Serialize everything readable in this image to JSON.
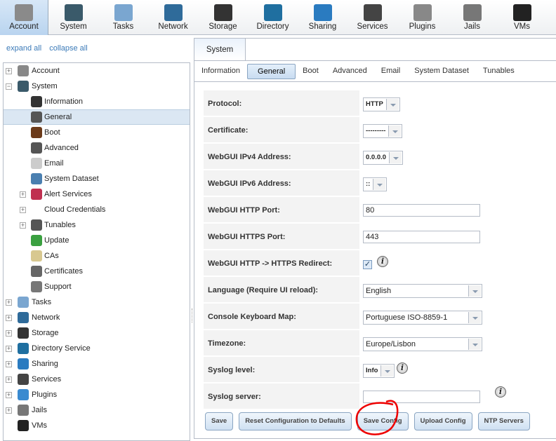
{
  "topnav": [
    {
      "label": "Account",
      "icon": "account-icon",
      "color": "#8a8a8a"
    },
    {
      "label": "System",
      "icon": "system-icon",
      "color": "#3a5a6a"
    },
    {
      "label": "Tasks",
      "icon": "tasks-icon",
      "color": "#7aa6d0"
    },
    {
      "label": "Network",
      "icon": "network-icon",
      "color": "#2f6b9a"
    },
    {
      "label": "Storage",
      "icon": "storage-icon",
      "color": "#333333"
    },
    {
      "label": "Directory",
      "icon": "directory-icon",
      "color": "#1f6fa0"
    },
    {
      "label": "Sharing",
      "icon": "sharing-icon",
      "color": "#2a7bc0"
    },
    {
      "label": "Services",
      "icon": "services-icon",
      "color": "#444444"
    },
    {
      "label": "Plugins",
      "icon": "plugins-icon",
      "color": "#888888"
    },
    {
      "label": "Jails",
      "icon": "jails-icon",
      "color": "#777777"
    },
    {
      "label": "VMs",
      "icon": "vms-icon",
      "color": "#222222"
    }
  ],
  "left": {
    "expand_all": "expand all",
    "collapse_all": "collapse all"
  },
  "tree": [
    {
      "label": "Account",
      "level": 0,
      "exp": "+",
      "icon": "account-icon",
      "color": "#888888"
    },
    {
      "label": "System",
      "level": 0,
      "exp": "−",
      "icon": "system-icon",
      "color": "#3a5a6a"
    },
    {
      "label": "Information",
      "level": 1,
      "icon": "information-icon",
      "color": "#333333"
    },
    {
      "label": "General",
      "level": 1,
      "icon": "wrench-icon",
      "color": "#555555",
      "selected": true
    },
    {
      "label": "Boot",
      "level": 1,
      "icon": "boot-icon",
      "color": "#6b3a1a"
    },
    {
      "label": "Advanced",
      "level": 1,
      "icon": "wrench-icon",
      "color": "#555555"
    },
    {
      "label": "Email",
      "level": 1,
      "icon": "email-icon",
      "color": "#cccccc"
    },
    {
      "label": "System Dataset",
      "level": 1,
      "icon": "dataset-icon",
      "color": "#4a7fb0"
    },
    {
      "label": "Alert Services",
      "level": 1,
      "exp": "+",
      "icon": "alert-icon",
      "color": "#c03050"
    },
    {
      "label": "Cloud Credentials",
      "level": 1,
      "exp": "+",
      "icon": "",
      "color": ""
    },
    {
      "label": "Tunables",
      "level": 1,
      "exp": "+",
      "icon": "tunables-icon",
      "color": "#555555"
    },
    {
      "label": "Update",
      "level": 1,
      "icon": "update-icon",
      "color": "#3aa040"
    },
    {
      "label": "CAs",
      "level": 1,
      "icon": "ca-icon",
      "color": "#d8c890"
    },
    {
      "label": "Certificates",
      "level": 1,
      "icon": "certificate-icon",
      "color": "#666666"
    },
    {
      "label": "Support",
      "level": 1,
      "icon": "support-icon",
      "color": "#777777"
    },
    {
      "label": "Tasks",
      "level": 0,
      "exp": "+",
      "icon": "tasks-icon",
      "color": "#7aa6d0"
    },
    {
      "label": "Network",
      "level": 0,
      "exp": "+",
      "icon": "network-icon",
      "color": "#2f6b9a"
    },
    {
      "label": "Storage",
      "level": 0,
      "exp": "+",
      "icon": "storage-icon",
      "color": "#333333"
    },
    {
      "label": "Directory Service",
      "level": 0,
      "exp": "+",
      "icon": "directory-icon",
      "color": "#1f6fa0"
    },
    {
      "label": "Sharing",
      "level": 0,
      "exp": "+",
      "icon": "sharing-icon",
      "color": "#2a7bc0"
    },
    {
      "label": "Services",
      "level": 0,
      "exp": "+",
      "icon": "services-icon",
      "color": "#444444"
    },
    {
      "label": "Plugins",
      "level": 0,
      "exp": "+",
      "icon": "plugins-icon",
      "color": "#3a8ad0"
    },
    {
      "label": "Jails",
      "level": 0,
      "exp": "+",
      "icon": "jails-icon",
      "color": "#777777"
    },
    {
      "label": "VMs",
      "level": 0,
      "icon": "vms-icon",
      "color": "#222222"
    }
  ],
  "main": {
    "section_tab": "System",
    "subtabs": [
      "Information",
      "General",
      "Boot",
      "Advanced",
      "Email",
      "System Dataset",
      "Tunables"
    ],
    "active_subtab": "General",
    "fields": [
      {
        "label": "Protocol:",
        "type": "select",
        "value": "HTTP"
      },
      {
        "label": "Certificate:",
        "type": "select",
        "value": "---------"
      },
      {
        "label": "WebGUI IPv4 Address:",
        "type": "select",
        "value": "0.0.0.0"
      },
      {
        "label": "WebGUI IPv6 Address:",
        "type": "select",
        "value": "::"
      },
      {
        "label": "WebGUI HTTP Port:",
        "type": "text",
        "value": "80"
      },
      {
        "label": "WebGUI HTTPS Port:",
        "type": "text",
        "value": "443"
      },
      {
        "label": "WebGUI HTTP -> HTTPS Redirect:",
        "type": "checkbox",
        "value": true,
        "info": true
      },
      {
        "label": "Language (Require UI reload):",
        "type": "wideselect",
        "value": "English"
      },
      {
        "label": "Console Keyboard Map:",
        "type": "wideselect",
        "value": "Portuguese ISO-8859-1"
      },
      {
        "label": "Timezone:",
        "type": "wideselect",
        "value": "Europe/Lisbon"
      },
      {
        "label": "Syslog level:",
        "type": "select",
        "value": "Info",
        "info": true
      },
      {
        "label": "Syslog server:",
        "type": "text",
        "value": "",
        "info": true
      }
    ],
    "buttons": [
      "Save",
      "Reset Configuration to Defaults",
      "Save Config",
      "Upload Config",
      "NTP Servers"
    ]
  }
}
